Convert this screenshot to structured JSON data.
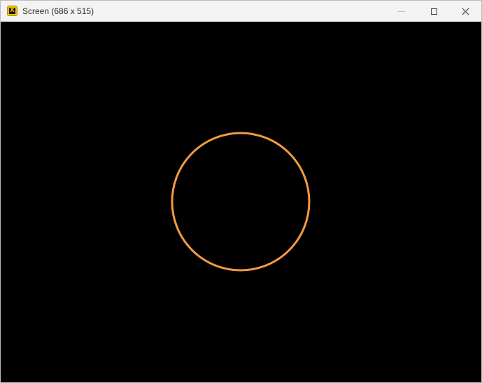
{
  "window": {
    "title": "Screen (686 x 515)",
    "app_icon": "x-app-icon",
    "controls": {
      "minimize_icon": "minimize-icon",
      "maximize_icon": "maximize-icon",
      "close_icon": "close-icon"
    }
  },
  "canvas": {
    "background_color": "#000000",
    "shape": {
      "type": "circle",
      "stroke_color": "#f39b40"
    }
  }
}
